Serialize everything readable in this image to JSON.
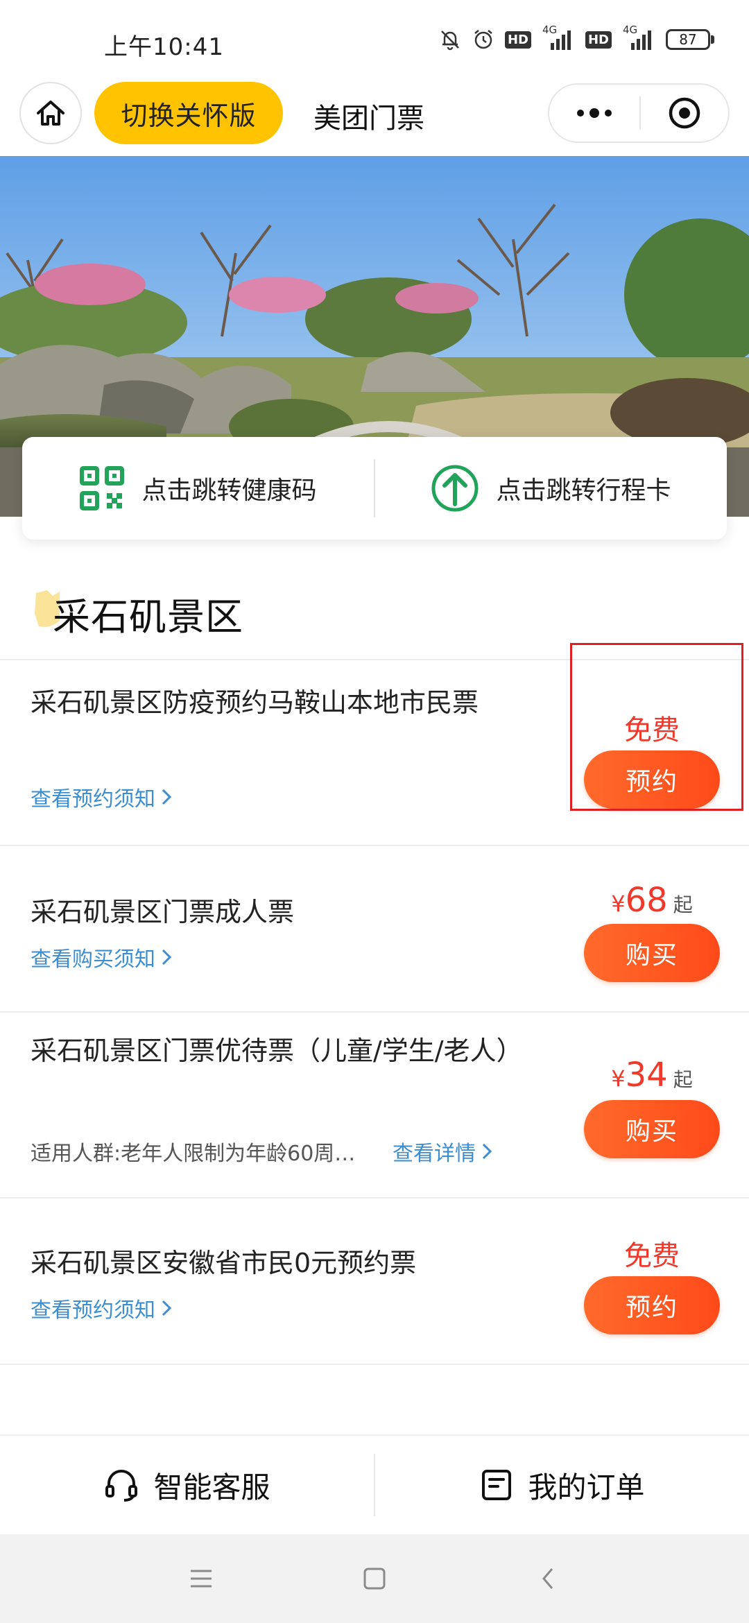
{
  "status_bar": {
    "time": "上午10:41",
    "hd_1": "HD",
    "hd_2": "HD",
    "network_1": "4G",
    "network_2": "4G",
    "battery": "87",
    "icons": [
      "mute-bell-icon",
      "alarm-icon",
      "signal-icon",
      "battery-icon"
    ]
  },
  "nav": {
    "care_mode_label": "切换关怀版",
    "title": "美团门票"
  },
  "quick_links": {
    "health_code": "点击跳转健康码",
    "trip_card": "点击跳转行程卡"
  },
  "section": {
    "title": "采石矶景区"
  },
  "tickets": [
    {
      "name": "采石矶景区防疫预约马鞍山本地市民票",
      "link": "查看预约须知",
      "price_label": "免费",
      "action": "预约"
    },
    {
      "name": "采石矶景区门票成人票",
      "link": "查看购买须知",
      "currency": "¥",
      "price": "68",
      "price_suffix": "起",
      "action": "购买"
    },
    {
      "name": "采石矶景区门票优待票（儿童/学生/老人）",
      "desc": "适用人群:老年人限制为年龄60周…",
      "detail_link": "查看详情",
      "currency": "¥",
      "price": "34",
      "price_suffix": "起",
      "action": "购买"
    },
    {
      "name": "采石矶景区安徽省市民0元预约票",
      "link": "查看预约须知",
      "price_label": "免费",
      "action": "预约"
    }
  ],
  "bottom_bar": {
    "service": "智能客服",
    "orders": "我的订单"
  },
  "colors": {
    "accent_yellow": "#ffc300",
    "price_red": "#f0392b",
    "button_orange": "#ff5a22",
    "link_blue": "#3a8ed1",
    "qr_green": "#22a35a"
  }
}
